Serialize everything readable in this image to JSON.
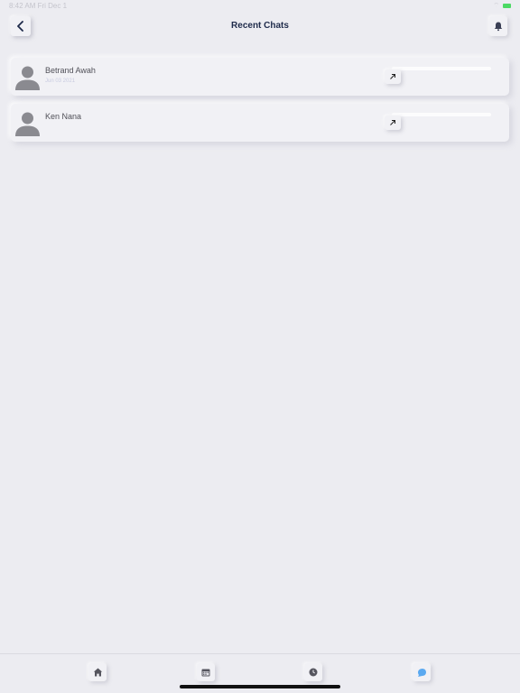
{
  "status": {
    "time": "8:42 AM",
    "date": "Fri Dec 1",
    "wifi": "⌔",
    "battery_color": "#4cd964"
  },
  "header": {
    "title": "Recent Chats",
    "back_icon": "chevron-left-icon",
    "bell_icon": "bell-icon"
  },
  "chats": [
    {
      "name": "Betrand Awah",
      "date": "Jun 03 2021",
      "icon": "arrow-up-right-icon"
    },
    {
      "name": "Ken Nana",
      "date": "",
      "icon": "arrow-up-right-icon"
    }
  ],
  "tabs": [
    {
      "icon": "home-icon",
      "active": false
    },
    {
      "icon": "calendar-icon",
      "active": false
    },
    {
      "icon": "clock-icon",
      "active": false
    },
    {
      "icon": "chat-icon",
      "active": true,
      "color": "#5aa9f0"
    }
  ]
}
